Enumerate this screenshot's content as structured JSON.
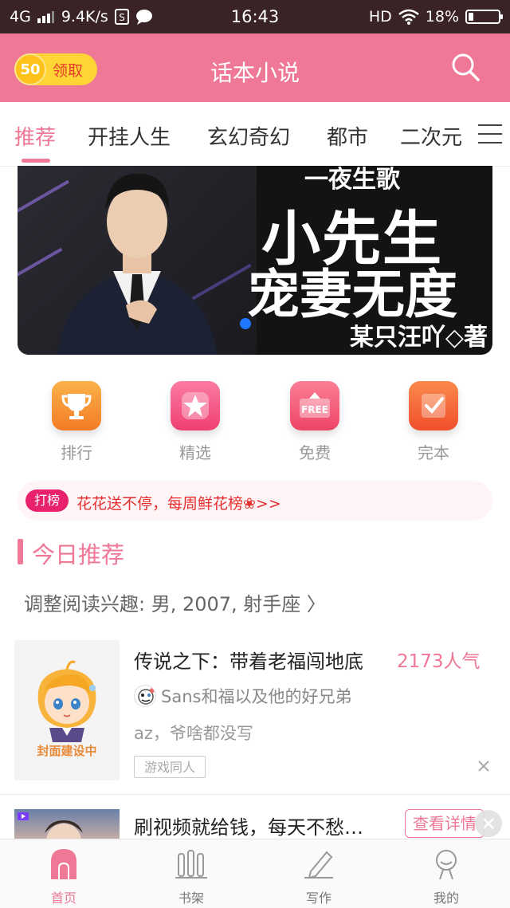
{
  "status_bar": {
    "network": "4G",
    "speed": "9.4K/s",
    "time": "16:43",
    "hd": "HD",
    "battery": "18%"
  },
  "app_bar": {
    "coin_value": "50",
    "coin_label": "领取",
    "title": "话本小说",
    "search_icon": "search-icon"
  },
  "tabs": [
    {
      "label": "推荐",
      "active": true
    },
    {
      "label": "开挂人生"
    },
    {
      "label": "玄幻奇幻"
    },
    {
      "label": "都市"
    },
    {
      "label": "二次元"
    }
  ],
  "banner": {
    "top_line": "一夜生歌",
    "line1": "小先生",
    "line2": "宠妻无度",
    "author": "某只汪吖◇著"
  },
  "categories": [
    {
      "label": "排行",
      "icon": "trophy-icon",
      "color": "#f7923a"
    },
    {
      "label": "精选",
      "icon": "star-icon",
      "color": "#f45a86"
    },
    {
      "label": "免费",
      "icon": "free-icon",
      "color": "#f2587a"
    },
    {
      "label": "完本",
      "icon": "checkbook-icon",
      "color": "#f46a3a"
    }
  ],
  "notice": {
    "badge": "打榜",
    "text": "花花送不停，每周鲜花榜❀>>"
  },
  "section": {
    "title": "今日推荐",
    "interest": "调整阅读兴趣: 男, 2007, 射手座 〉"
  },
  "book": {
    "cover_caption": "封面建设中",
    "title": "传说之下：带着老福闯地底",
    "popularity": "2173人气",
    "author": "Sans和福以及他的好兄弟",
    "description": "az，爷啥都没写",
    "tag": "游戏同人"
  },
  "ad": {
    "title": "刷视频就给钱，每天不愁…",
    "button": "查看详情"
  },
  "bottom_nav": [
    {
      "label": "首页",
      "icon": "home-icon",
      "active": true
    },
    {
      "label": "书架",
      "icon": "bookshelf-icon"
    },
    {
      "label": "写作",
      "icon": "pen-icon"
    },
    {
      "label": "我的",
      "icon": "profile-icon"
    }
  ],
  "colors": {
    "primary": "#ee7896",
    "statusbar": "#3a2326",
    "coin": "#ffd535"
  }
}
